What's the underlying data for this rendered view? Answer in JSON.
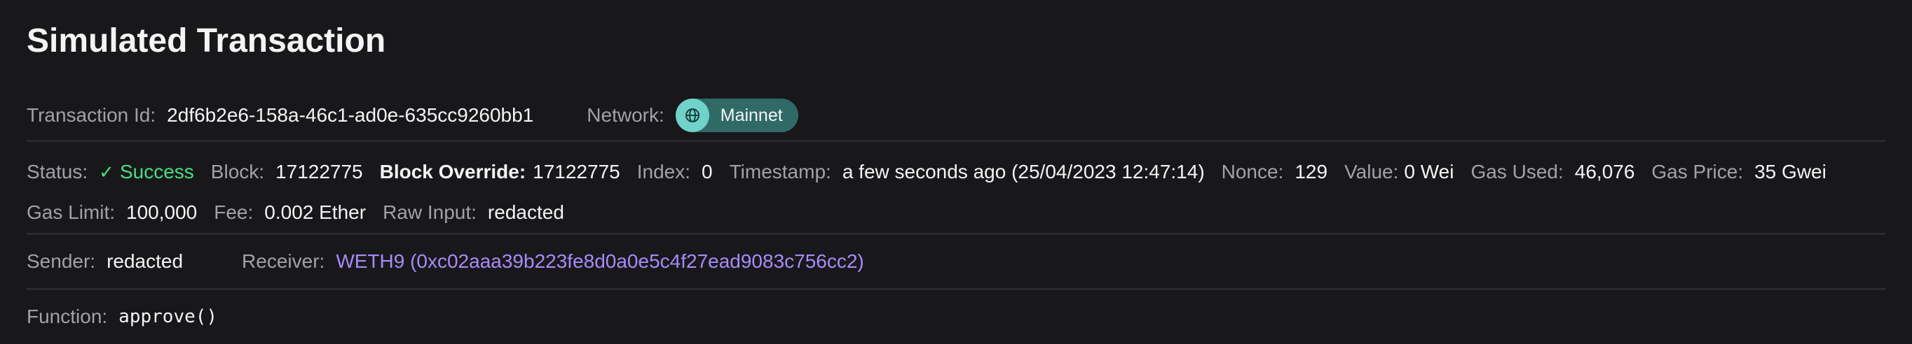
{
  "page_title": "Simulated Transaction",
  "transaction": {
    "id_label": "Transaction Id:",
    "id_value": "2df6b2e6-158a-46c1-ad0e-635cc9260bb1",
    "network_label": "Network:",
    "network_value": "Mainnet"
  },
  "status": {
    "status_label": "Status:",
    "status_value": "Success",
    "block_label": "Block:",
    "block_value": "17122775",
    "block_override_label": "Block Override:",
    "block_override_value": "17122775",
    "index_label": "Index:",
    "index_value": "0",
    "timestamp_label": "Timestamp:",
    "timestamp_value": "a few seconds ago (25/04/2023 12:47:14)",
    "nonce_label": "Nonce:",
    "nonce_value": "129",
    "value_label": "Value:",
    "value_value": "0 Wei",
    "gas_used_label": "Gas Used:",
    "gas_used_value": "46,076",
    "gas_price_label": "Gas Price:",
    "gas_price_value": "35 Gwei",
    "gas_limit_label": "Gas Limit:",
    "gas_limit_value": "100,000",
    "fee_label": "Fee:",
    "fee_value": "0.002 Ether",
    "raw_input_label": "Raw Input:",
    "raw_input_value": "redacted"
  },
  "parties": {
    "sender_label": "Sender:",
    "sender_value": "redacted",
    "receiver_label": "Receiver:",
    "receiver_value": "WETH9 (0xc02aaa39b223fe8d0a0e5c4f27ead9083c756cc2)"
  },
  "function": {
    "label": "Function:",
    "value": "approve()"
  },
  "icons": {
    "network": "globe-icon",
    "status": "check-icon"
  },
  "colors": {
    "background": "#18181b",
    "success": "#4ade80",
    "link": "#a78bfa",
    "network_pill": "#2f6a67",
    "network_icon_bg": "#6fd3c9"
  }
}
